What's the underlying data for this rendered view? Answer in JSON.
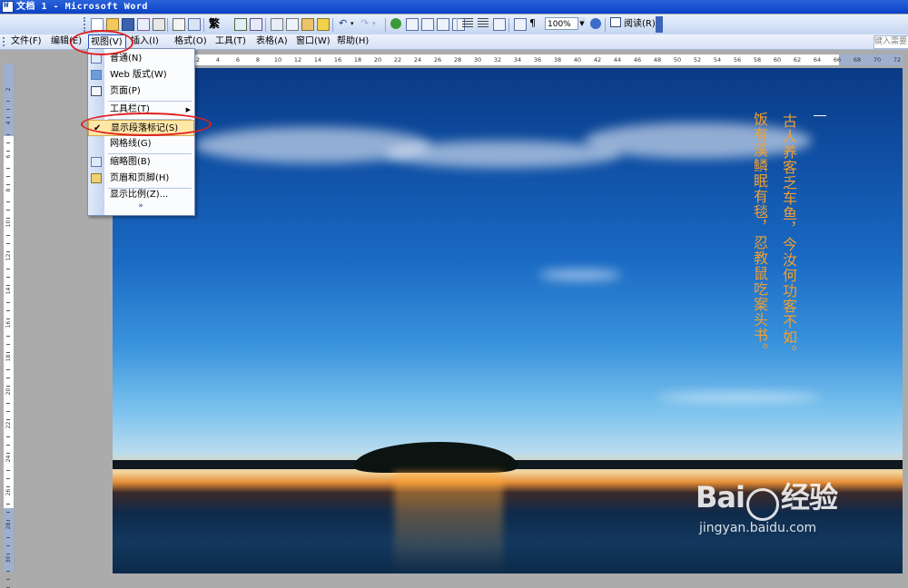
{
  "window": {
    "title": "文档 1 - Microsoft Word"
  },
  "toolbar": {
    "zoom_value": "100%",
    "read_label": "阅读(R)",
    "dropdown_arrow": "▼"
  },
  "menubar": {
    "items": [
      {
        "label": "文件(F)"
      },
      {
        "label": "编辑(E)"
      },
      {
        "label": "视图(V)"
      },
      {
        "label": "插入(I)"
      },
      {
        "label": "格式(O)"
      },
      {
        "label": "工具(T)"
      },
      {
        "label": "表格(A)"
      },
      {
        "label": "窗口(W)"
      },
      {
        "label": "帮助(H)"
      }
    ],
    "help_placeholder": "键入需要"
  },
  "view_menu": {
    "items": [
      {
        "label": "普通(N)",
        "icon": "normal-view-icon"
      },
      {
        "label": "Web 版式(W)",
        "icon": "web-layout-icon"
      },
      {
        "label": "页面(P)",
        "icon": "page-layout-icon"
      },
      {
        "label": "工具栏(T)",
        "submenu": true
      },
      {
        "label": "显示段落标记(S)",
        "checked": true,
        "highlighted": true
      },
      {
        "label": "网格线(G)"
      },
      {
        "label": "缩略图(B)",
        "icon": "thumbnail-icon"
      },
      {
        "label": "页眉和页脚(H)",
        "icon": "header-footer-icon"
      },
      {
        "label": "显示比例(Z)..."
      }
    ],
    "more_glyph": "»",
    "check_glyph": "✔",
    "submenu_glyph": "▶"
  },
  "ruler": {
    "h_ticks": [
      "2",
      "4",
      "6",
      "8",
      "10",
      "12",
      "14",
      "16",
      "18",
      "20",
      "22",
      "24",
      "26",
      "28",
      "30",
      "32",
      "34",
      "36",
      "38",
      "40",
      "42",
      "44",
      "46",
      "48",
      "50",
      "52",
      "54",
      "56",
      "58",
      "60",
      "62",
      "64",
      "66",
      "68",
      "70",
      "72"
    ],
    "v_ticks": [
      "2",
      "4",
      "6",
      "8",
      "10",
      "12",
      "14",
      "16",
      "18",
      "20",
      "22",
      "24",
      "26",
      "28",
      "30"
    ]
  },
  "document": {
    "poem_line1": "古人养客乏车鱼，今汝何功客不如。",
    "poem_line2": "饭有溪鳞眠有毯，忍教鼠吃案头书。"
  },
  "watermark": {
    "logo": "Bai",
    "logo_suffix": "经验",
    "url": "jingyan.baidu.com"
  },
  "colors": {
    "title_bar": "#0A43C8",
    "poem": "#F0A030",
    "highlight_ellipse": "#E02020"
  }
}
